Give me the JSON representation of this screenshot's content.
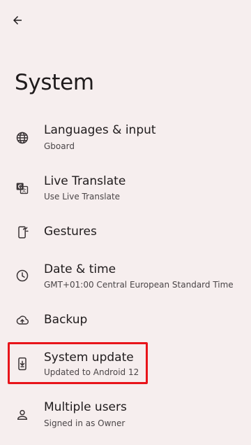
{
  "header": {
    "back_icon": "arrow-back-icon",
    "title": "System"
  },
  "items": [
    {
      "icon": "globe-icon",
      "title": "Languages & input",
      "subtitle": "Gboard"
    },
    {
      "icon": "translate-icon",
      "title": "Live Translate",
      "subtitle": "Use Live Translate"
    },
    {
      "icon": "gestures-icon",
      "title": "Gestures",
      "subtitle": ""
    },
    {
      "icon": "clock-icon",
      "title": "Date & time",
      "subtitle": "GMT+01:00 Central European Standard Time"
    },
    {
      "icon": "cloud-upload-icon",
      "title": "Backup",
      "subtitle": ""
    },
    {
      "icon": "system-update-icon",
      "title": "System update",
      "subtitle": "Updated to Android 12"
    },
    {
      "icon": "person-icon",
      "title": "Multiple users",
      "subtitle": "Signed in as Owner"
    }
  ],
  "highlight_color": "#e8141a"
}
